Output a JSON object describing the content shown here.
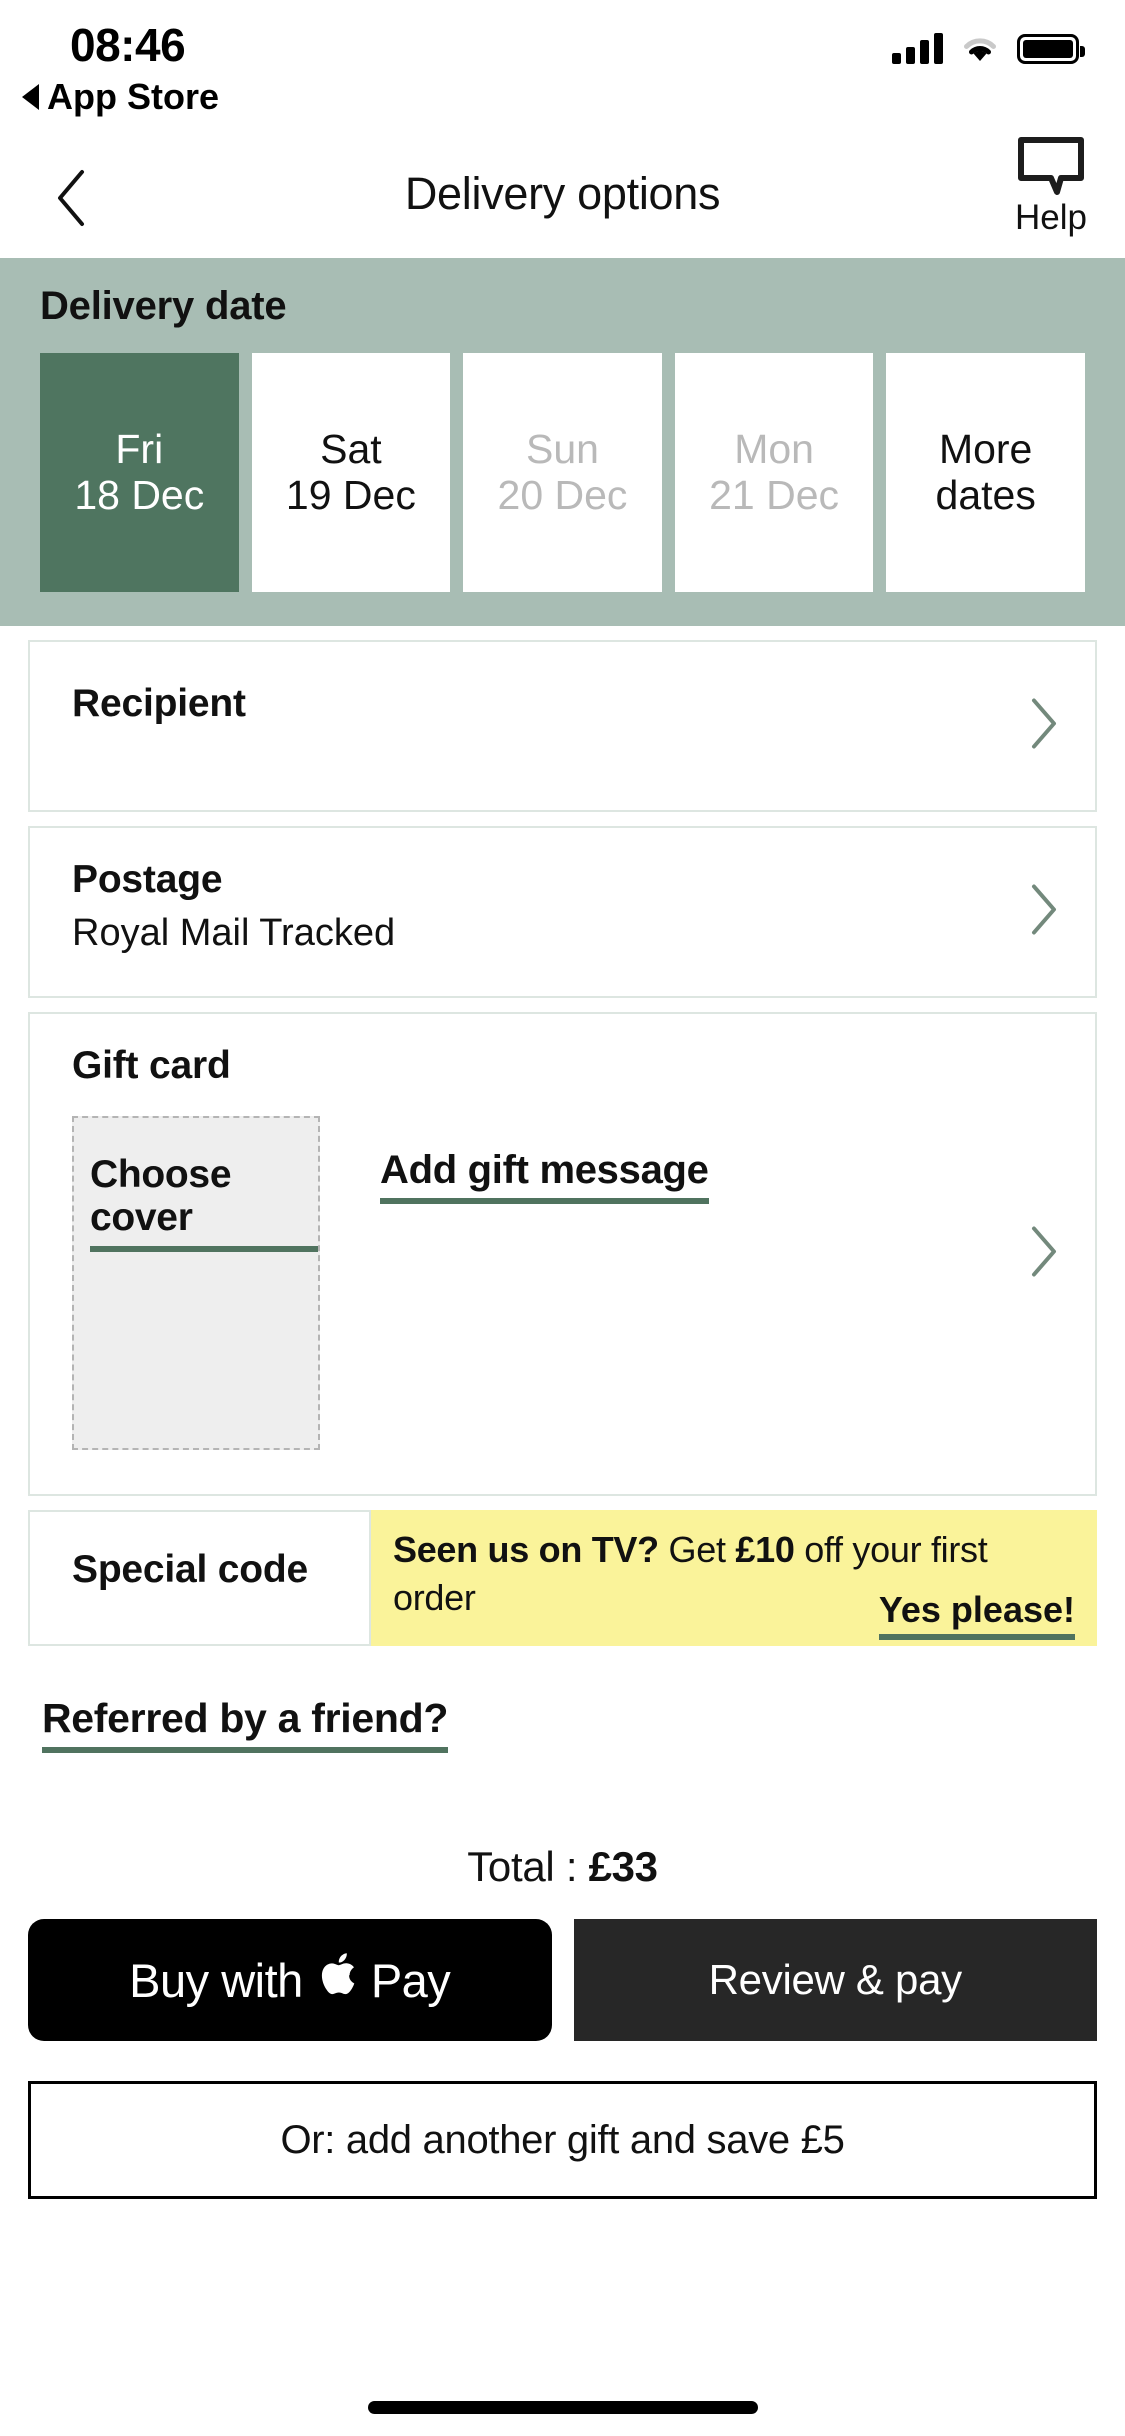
{
  "status_bar": {
    "time": "08:46",
    "back_to_app": "App Store",
    "icons": [
      "signal-bars-icon",
      "wifi-icon",
      "battery-icon"
    ]
  },
  "nav": {
    "back_icon": "chevron-left-icon",
    "title": "Delivery options",
    "help_icon": "speech-bubble-icon",
    "help_label": "Help"
  },
  "delivery_date": {
    "title": "Delivery date",
    "options": [
      {
        "dow": "Fri",
        "dom": "18 Dec",
        "state": "selected"
      },
      {
        "dow": "Sat",
        "dom": "19 Dec",
        "state": "available"
      },
      {
        "dow": "Sun",
        "dom": "20 Dec",
        "state": "disabled"
      },
      {
        "dow": "Mon",
        "dom": "21 Dec",
        "state": "disabled"
      },
      {
        "dow": "More",
        "dom": "dates",
        "state": "available"
      }
    ]
  },
  "recipient": {
    "label": "Recipient",
    "chevron_icon": "chevron-right-icon"
  },
  "postage": {
    "label": "Postage",
    "value": "Royal Mail Tracked",
    "chevron_icon": "chevron-right-icon"
  },
  "gift_card": {
    "title": "Gift card",
    "choose_cover": "Choose cover",
    "add_message": "Add gift message",
    "chevron_icon": "chevron-right-icon"
  },
  "special_code": {
    "label": "Special code"
  },
  "promo": {
    "lead": "Seen us on TV?",
    "mid": " Get ",
    "amount": "£10",
    "tail": " off your first order",
    "cta": "Yes please!",
    "background": "#faf39a"
  },
  "referral": {
    "label": "Referred by a friend?"
  },
  "totals": {
    "label": "Total : ",
    "amount": "£33"
  },
  "actions": {
    "apple_pay_prefix": "Buy with",
    "apple_glyph": "",
    "apple_pay_suffix": "Pay",
    "review_pay": "Review & pay",
    "add_another": "Or: add another gift and save £5"
  },
  "colors": {
    "sage": "#a8bdb4",
    "deep_green": "#4f7560",
    "underline_green": "#50735f",
    "chevron_green": "#73897c",
    "promo_yellow": "#faf39a",
    "border": "#dde6e1"
  }
}
